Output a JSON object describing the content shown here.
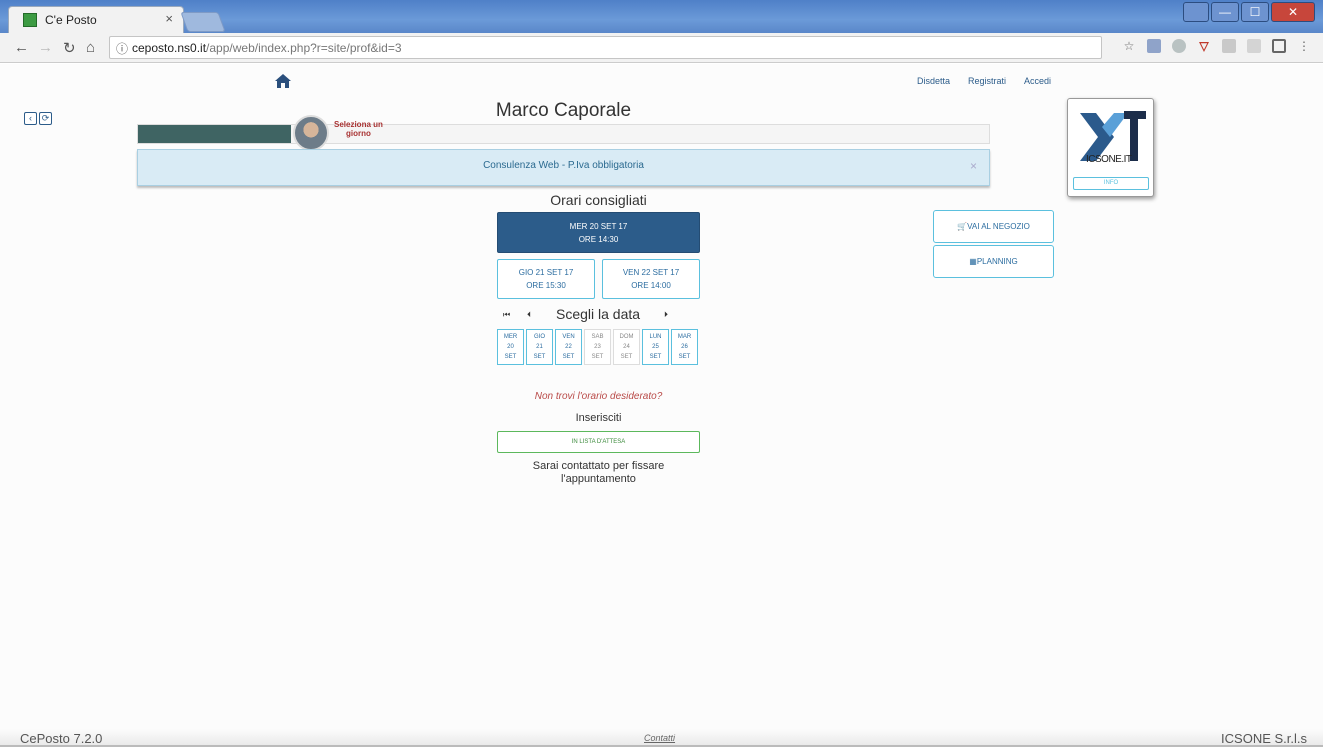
{
  "browser": {
    "tab_title": "C'e Posto",
    "tab_close": "×",
    "url_domain": "ceposto.ns0.it",
    "url_path": "/app/web/index.php?r=site/prof&id=3"
  },
  "header": {
    "links": [
      "Disdetta",
      "Registrati",
      "Accedi"
    ]
  },
  "profile": {
    "name": "Marco Caporale",
    "progress_fraction": 0.18,
    "select_day_line1": "Seleziona un",
    "select_day_line2": "giorno"
  },
  "alert": {
    "message": "Consulenza Web - P.Iva obbligatoria",
    "close": "×"
  },
  "logo": {
    "text": "ICSONE.IT",
    "info_label": "INFO"
  },
  "orari": {
    "title": "Orari consigliati",
    "slots": [
      {
        "date": "MER 20 SET 17",
        "time": "ORE 14:30"
      },
      {
        "date": "GIO 21 SET 17",
        "time": "ORE 15:30"
      },
      {
        "date": "VEN 22 SET 17",
        "time": "ORE 14:00"
      }
    ]
  },
  "shop": {
    "negozio_label": "VAI AL NEGOZIO",
    "planning_label": "PLANNING"
  },
  "calendar": {
    "title": "Scegli la data",
    "days": [
      {
        "dow": "MER",
        "day": "20",
        "month": "SET",
        "available": true
      },
      {
        "dow": "GIO",
        "day": "21",
        "month": "SET",
        "available": true
      },
      {
        "dow": "VEN",
        "day": "22",
        "month": "SET",
        "available": true
      },
      {
        "dow": "SAB",
        "day": "23",
        "month": "SET",
        "available": false
      },
      {
        "dow": "DOM",
        "day": "24",
        "month": "SET",
        "available": false
      },
      {
        "dow": "LUN",
        "day": "25",
        "month": "SET",
        "available": true
      },
      {
        "dow": "MAR",
        "day": "26",
        "month": "SET",
        "available": true
      }
    ]
  },
  "waitlist": {
    "not_found": "Non trovi l'orario desiderato?",
    "inserisciti": "Inserisciti",
    "button_label": "IN LISTA D'ATTESA",
    "contact_line1": "Sarai contattato per fissare",
    "contact_line2": "l'appuntamento"
  },
  "footer": {
    "version": "CePosto 7.2.0",
    "contacts": "Contatti",
    "company": "ICSONE S.r.l.s"
  },
  "colors": {
    "primary": "#2c5c8a",
    "info": "#5bc0de",
    "success": "#5cb85c",
    "progress": "#3f6463"
  }
}
